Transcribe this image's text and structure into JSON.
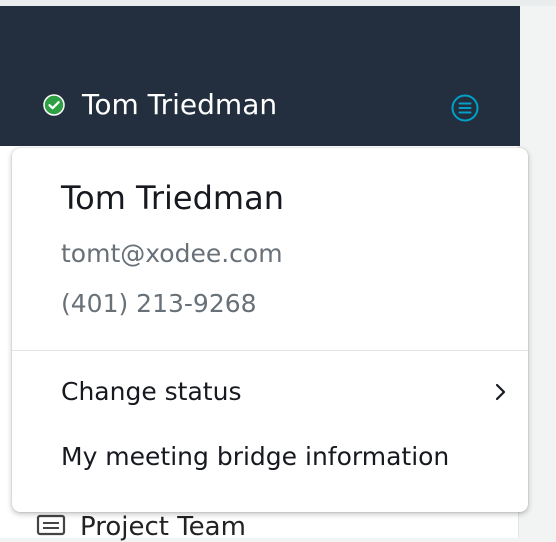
{
  "header": {
    "user_name": "Tom Triedman",
    "status_color": "#2ea043",
    "accent_color": "#00a1c9",
    "status_icon": "check-circle-icon",
    "menu_icon": "menu-circle-icon"
  },
  "dropdown": {
    "name": "Tom Triedman",
    "email": "tomt@xodee.com",
    "phone": "(401) 213-9268",
    "items": [
      {
        "label": "Change status",
        "icon": "chevron-right-icon"
      },
      {
        "label": "My meeting bridge information"
      }
    ]
  },
  "background": {
    "list_item_label": "Project Team",
    "list_item_icon": "chat-room-icon"
  }
}
